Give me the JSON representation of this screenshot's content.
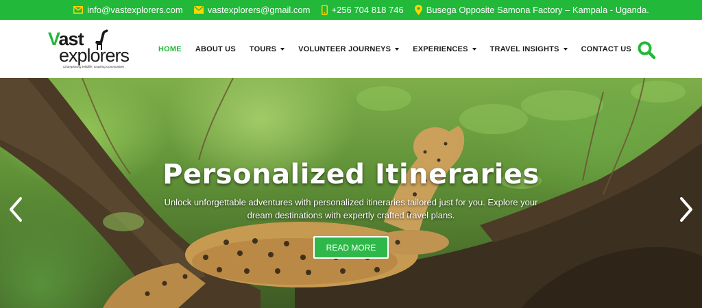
{
  "topbar": {
    "email1": "info@vastexplorers.com",
    "email2": "vastexplorers@gmail.com",
    "phone": "+256 704 818 746",
    "address": "Busega Opposite Samona Factory – Kampala - Uganda."
  },
  "logo": {
    "v": "V",
    "line1_rest": "ast",
    "line2": "explorers",
    "tagline": "Championing Wildlife, Inspiring Communities"
  },
  "nav": [
    {
      "label": "HOME",
      "active": true,
      "dropdown": false
    },
    {
      "label": "ABOUT US",
      "dropdown": false
    },
    {
      "label": "TOURS",
      "dropdown": true
    },
    {
      "label": "VOLUNTEER JOURNEYS",
      "dropdown": true
    },
    {
      "label": "EXPERIENCES",
      "dropdown": true
    },
    {
      "label": "TRAVEL INSIGHTS",
      "dropdown": true
    },
    {
      "label": "CONTACT US",
      "dropdown": false
    }
  ],
  "hero": {
    "title": "Personalized Itineraries",
    "subtitle": "Unlock unforgettable adventures with personalized itineraries tailored just for you. Explore your dream destinations with expertly crafted travel plans.",
    "button": "READ MORE"
  },
  "colors": {
    "brand_green": "#22b83a",
    "button_green": "#2fb84a"
  },
  "icons": [
    "email-icon",
    "email-icon",
    "phone-icon",
    "location-pin-icon",
    "search-icon",
    "chevron-left-icon",
    "chevron-right-icon"
  ]
}
